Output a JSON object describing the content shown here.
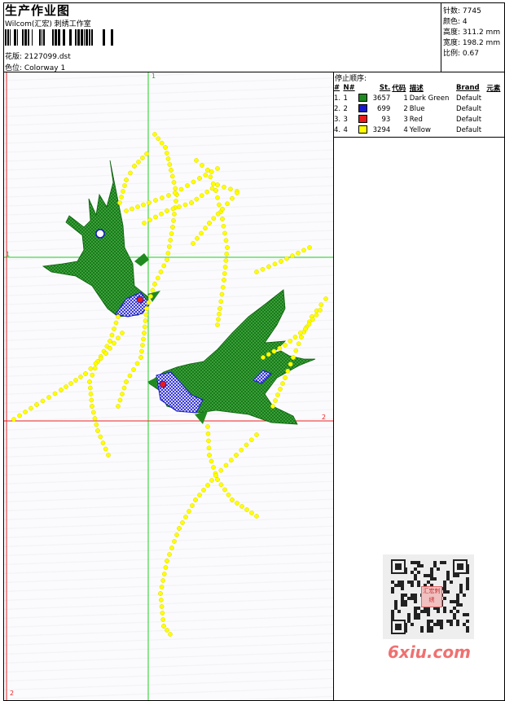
{
  "header": {
    "title": "生产作业图",
    "company": "Wilcom(汇宏) 刺绣工作室",
    "design_name": "花版: 2127099.dst",
    "colorway": "色位: Colorway 1"
  },
  "stats": [
    {
      "label": "针数",
      "value": "7745"
    },
    {
      "label": "颜色",
      "value": "4"
    },
    {
      "label": "高度",
      "value": "311.2 mm"
    },
    {
      "label": "宽度",
      "value": "198.2 mm"
    },
    {
      "label": "比例",
      "value": "0.67"
    }
  ],
  "stop_sequence": {
    "title": "停止顺序:",
    "headers": [
      "#",
      "N#",
      "St.",
      "代码",
      "描述",
      "Brand",
      "元素"
    ],
    "rows": [
      {
        "index": "1.",
        "needle": "1",
        "color": "#1f8a1f",
        "stitches": "3657",
        "code": "1",
        "description": "Dark Green",
        "brand": "Default",
        "element": ""
      },
      {
        "index": "2.",
        "needle": "2",
        "color": "#1a1acc",
        "stitches": "699",
        "code": "2",
        "description": "Blue",
        "brand": "Default",
        "element": ""
      },
      {
        "index": "3.",
        "needle": "3",
        "color": "#e81a1a",
        "stitches": "93",
        "code": "3",
        "description": "Red",
        "brand": "Default",
        "element": ""
      },
      {
        "index": "4.",
        "needle": "4",
        "color": "#ffff00",
        "stitches": "3294",
        "code": "4",
        "description": "Yellow",
        "brand": "Default",
        "element": ""
      }
    ]
  },
  "canvas": {
    "axis_labels": {
      "top_green": "1",
      "left_green": "1",
      "right_red": "2",
      "bottom_red": "2"
    }
  },
  "watermark": {
    "text": "6xiu.com",
    "seal_text": "汇宏刺绣"
  }
}
